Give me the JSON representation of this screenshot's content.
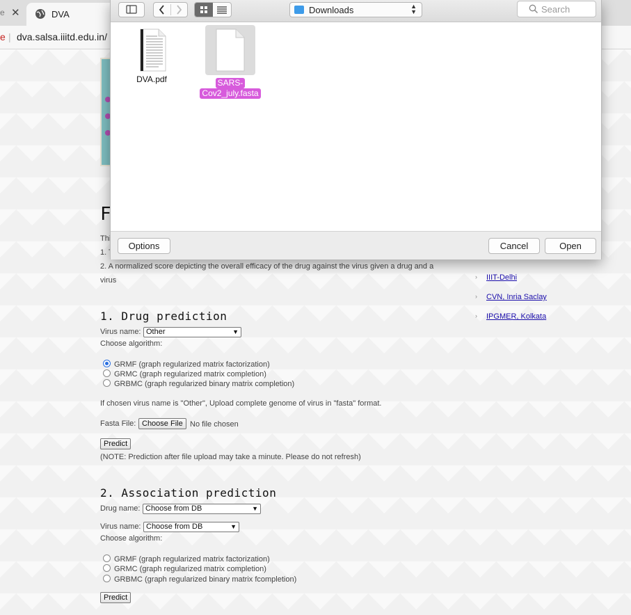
{
  "browser": {
    "prev_tab_stub": "e",
    "tab_title": "DVA",
    "url": "dva.salsa.iiitd.edu.in/",
    "warn": "e"
  },
  "page": {
    "heading_stub": "F",
    "intro_stub_1": "Thi",
    "intro_stub_2": "1. T",
    "intro_line": "2. A normalized score depicting the overall efficacy of the drug against the virus given a drug and a virus",
    "sidebar_links": [
      "IIIT-Delhi",
      "CVN, Inria Saclay",
      "IPGMER, Kolkata"
    ],
    "drug_section": {
      "title": "1. Drug prediction",
      "virus_label": "Virus name:",
      "virus_value": "Other",
      "algo_label": "Choose algorithm:",
      "options": [
        {
          "label": "GRMF (graph regularized matrix factorization)",
          "checked": true
        },
        {
          "label": "GRMC (graph regularized matrix completion)",
          "checked": false
        },
        {
          "label": "GRBMC (graph regularized binary matrix completion)",
          "checked": false
        }
      ],
      "upload_note": "If chosen virus name is \"Other\", Upload complete genome of virus in \"fasta\" format.",
      "fasta_label": "Fasta File:",
      "choose_file": "Choose File",
      "no_file": "No file chosen",
      "predict": "Predict",
      "predict_note": "(NOTE: Prediction after file upload may take a minute. Please do not refresh)"
    },
    "assoc_section": {
      "title": "2. Association prediction",
      "drug_label": "Drug name:",
      "drug_value": "Choose from DB",
      "virus_label": "Virus name:",
      "virus_value": "Choose from DB",
      "algo_label": "Choose algorithm:",
      "options": [
        {
          "label": "GRMF (graph regularized matrix factorization)",
          "checked": false
        },
        {
          "label": "GRMC (graph regularized matrix completion)",
          "checked": false
        },
        {
          "label": "GRBMC (graph regularized binary matrix fcompletion)",
          "checked": false
        }
      ],
      "predict": "Predict"
    }
  },
  "dialog": {
    "location": "Downloads",
    "search_placeholder": "Search",
    "files": [
      {
        "name": "DVA.pdf",
        "type": "pdf",
        "selected": false
      },
      {
        "name": "SARS-Cov2_july.fasta",
        "name_line1": "SARS-",
        "name_line2": "Cov2_july.fasta",
        "type": "generic",
        "selected": true
      }
    ],
    "options_button": "Options",
    "cancel_button": "Cancel",
    "open_button": "Open",
    "selection_color": "#d75bdc"
  }
}
